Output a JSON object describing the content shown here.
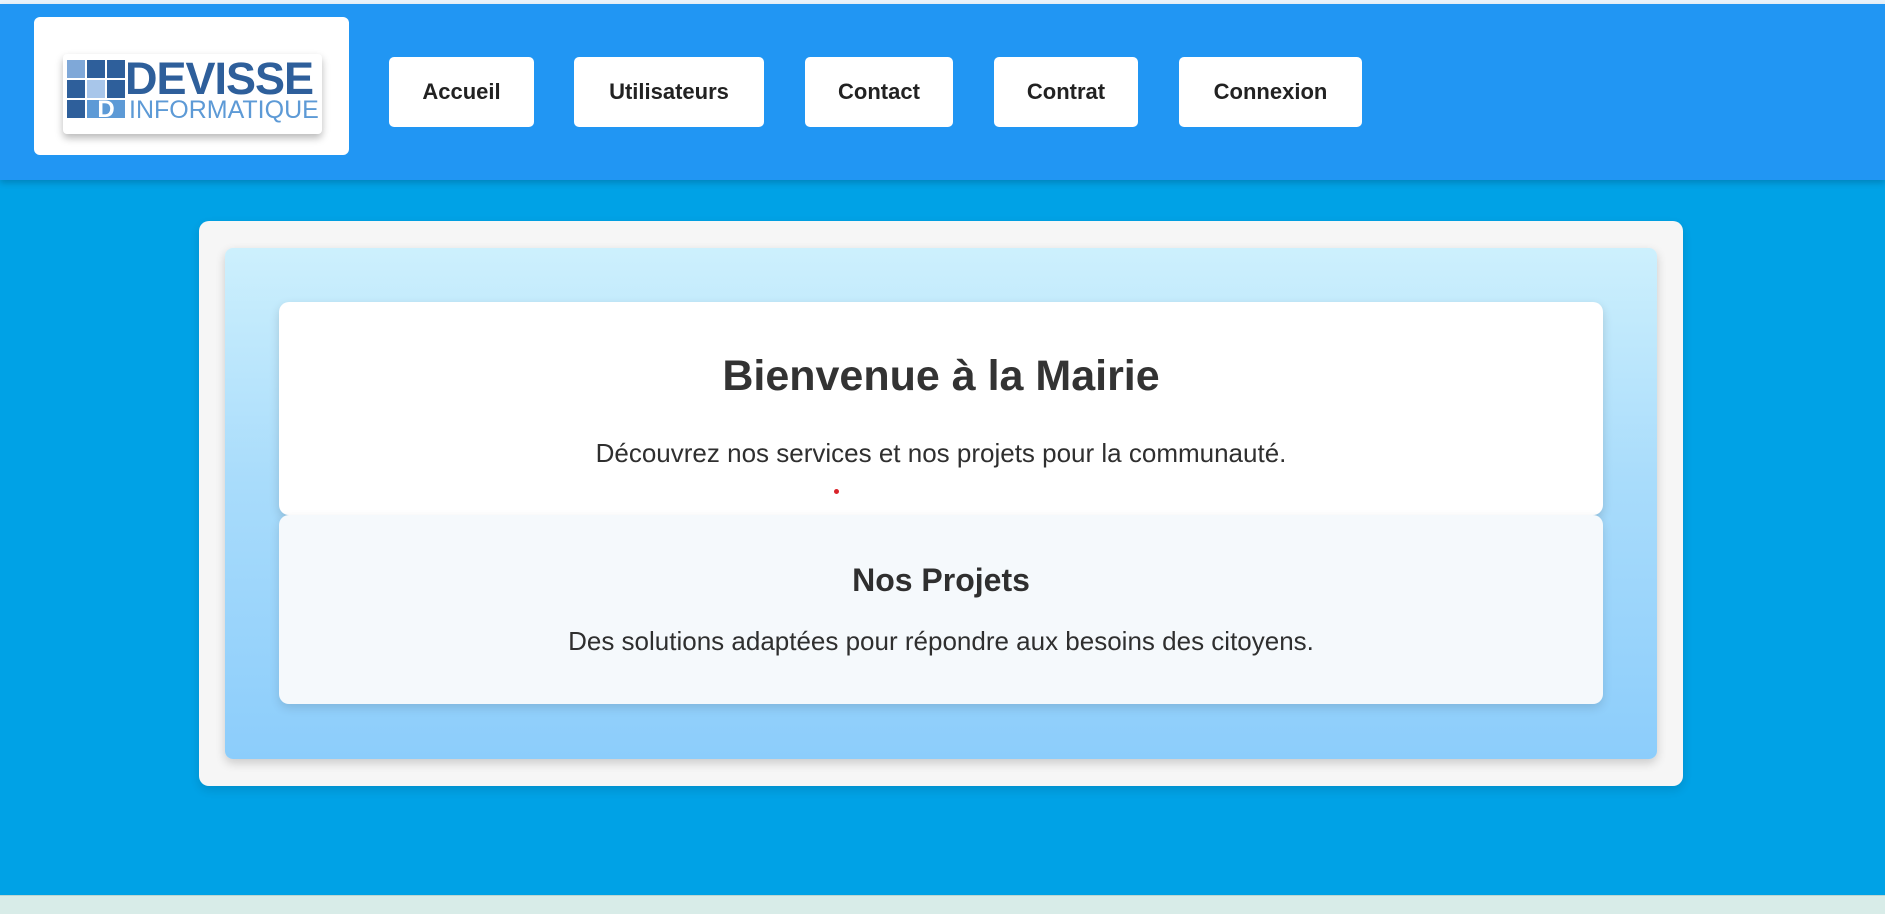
{
  "brand": {
    "name": "DEVISSE",
    "tagline": "INFORMATIQUE",
    "icon": "devisse-logo-icon"
  },
  "nav": {
    "items": [
      {
        "label": "Accueil"
      },
      {
        "label": "Utilisateurs"
      },
      {
        "label": "Contact"
      },
      {
        "label": "Contrat"
      },
      {
        "label": "Connexion"
      }
    ]
  },
  "welcome": {
    "title": "Bienvenue à la Mairie",
    "text": "Découvrez nos services et nos projets pour la communauté."
  },
  "projects": {
    "title": "Nos Projets",
    "text": "Des solutions adaptées pour répondre aux besoins des citoyens."
  },
  "colors": {
    "page_bg": "#00a2e6",
    "header_bg": "#2196f3",
    "logo_blue": "#2e5f9b",
    "logo_light_blue": "#5d9ad6",
    "panel_gradient_top": "#cdf0fd",
    "panel_gradient_bottom": "#8ccdfb",
    "text_dark": "#333333"
  }
}
